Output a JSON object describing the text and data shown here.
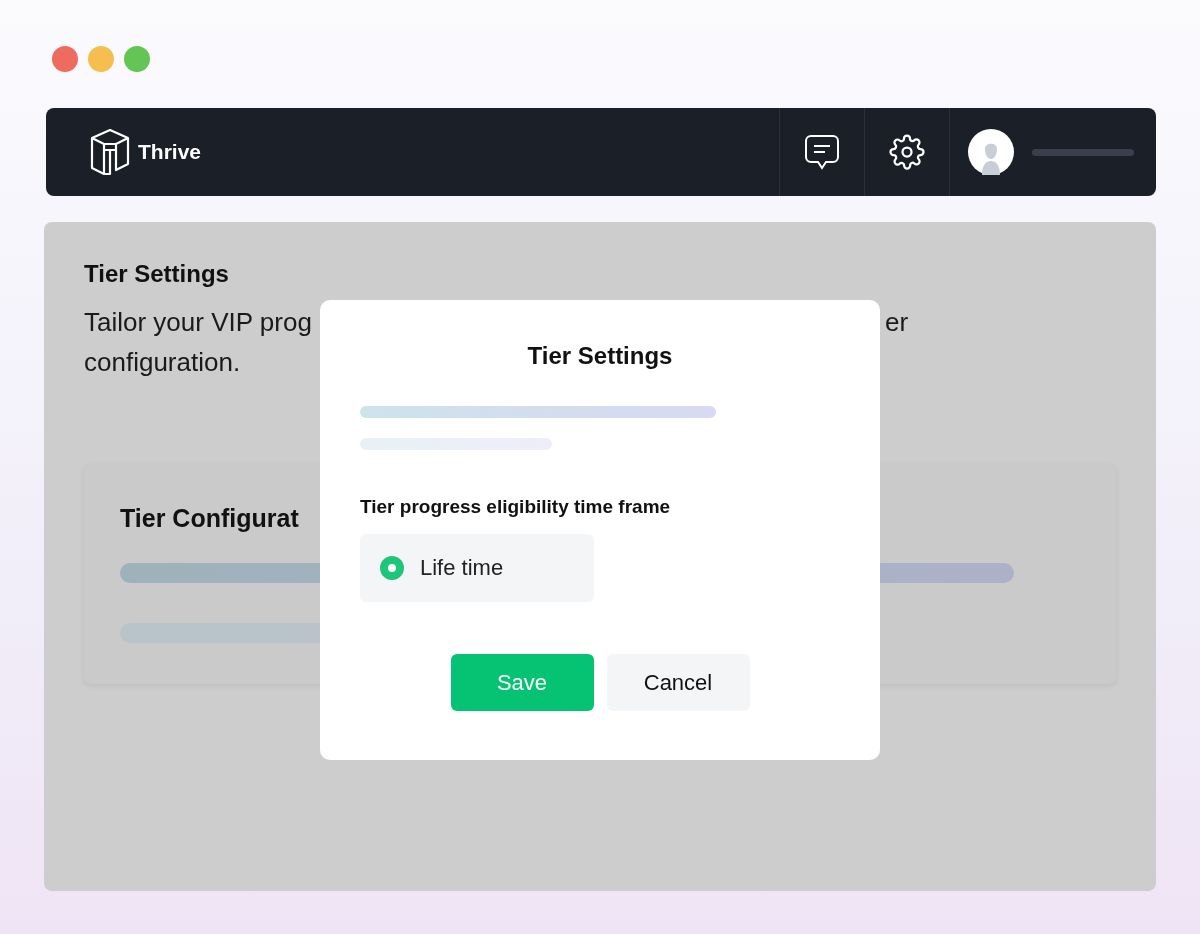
{
  "window": {
    "controls": [
      {
        "color": "#ee6b60"
      },
      {
        "color": "#f5be4f"
      },
      {
        "color": "#62c554"
      }
    ]
  },
  "navbar": {
    "brand": "Thrive"
  },
  "page": {
    "title": "Tier Settings",
    "description_visible": [
      "Tailor your VIP prog",
      "er",
      "configuration."
    ],
    "card": {
      "title": "Tier Configurat"
    }
  },
  "modal": {
    "title": "Tier Settings",
    "label": "Tier progress eligibility time frame",
    "options": [
      {
        "label": "Life time",
        "selected": true
      }
    ],
    "buttons": [
      {
        "kind": "primary",
        "label": "Save"
      },
      {
        "kind": "secondary",
        "label": "Cancel"
      }
    ]
  }
}
